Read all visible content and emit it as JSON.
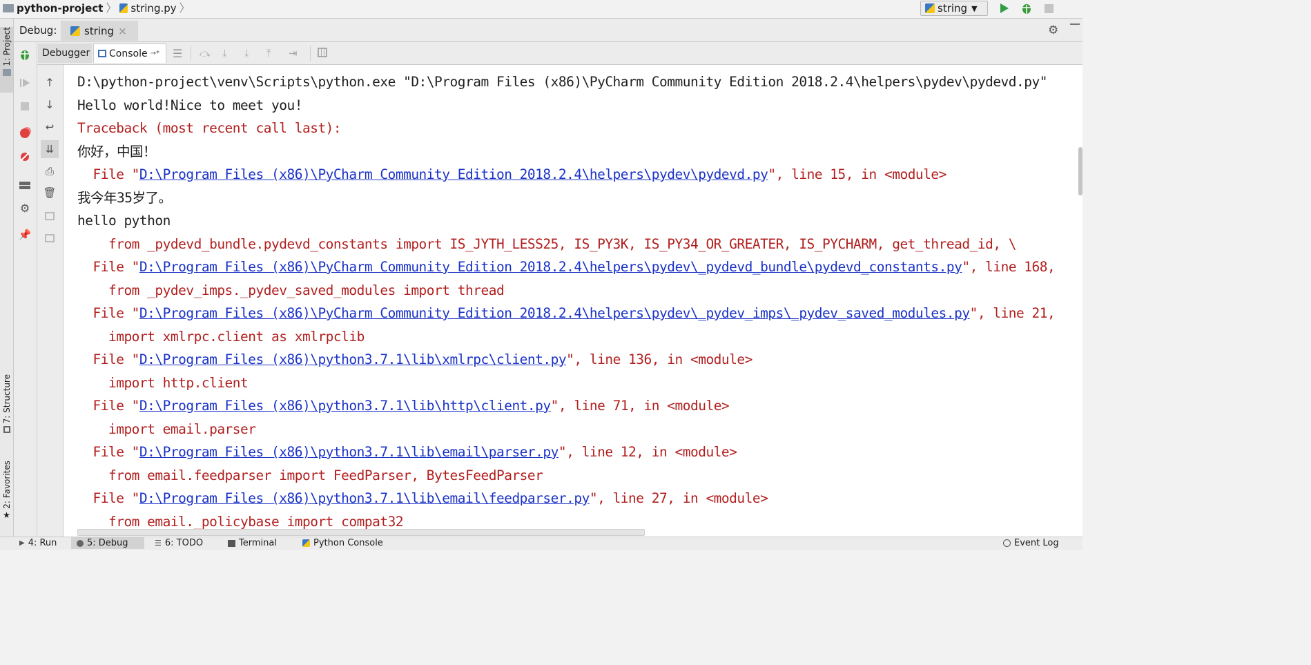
{
  "navbar": {
    "project": "python-project",
    "file": "string.py",
    "run_config": "string"
  },
  "left_stripe": {
    "project_tab": "1: Project",
    "structure_tab": "7: Structure",
    "favorites_tab": "2: Favorites"
  },
  "debug_header": {
    "label": "Debug:",
    "tab_label": "string",
    "tab_close": "×"
  },
  "tabs": {
    "debugger": "Debugger",
    "console": "Console",
    "console_suffix": "→*"
  },
  "console": {
    "lines": [
      {
        "segments": [
          {
            "t": "D:\\python-project\\venv\\Scripts\\python.exe \"D:\\Program Files (x86)\\PyCharm Community Edition 2018.2.4\\helpers\\pydev\\pydevd.py\"",
            "c": "norm"
          }
        ]
      },
      {
        "segments": [
          {
            "t": "Hello world!Nice to meet you!",
            "c": "norm"
          }
        ]
      },
      {
        "segments": [
          {
            "t": "Traceback (most recent call last):",
            "c": "err"
          }
        ]
      },
      {
        "segments": [
          {
            "t": "你好，中国！",
            "c": "norm"
          }
        ]
      },
      {
        "segments": [
          {
            "t": "  File \"",
            "c": "err"
          },
          {
            "t": "D:\\Program Files (x86)\\PyCharm Community Edition 2018.2.4\\helpers\\pydev\\pydevd.py",
            "c": "link"
          },
          {
            "t": "\", line 15, in <module>",
            "c": "err"
          }
        ]
      },
      {
        "segments": [
          {
            "t": "我今年35岁了。",
            "c": "norm"
          }
        ]
      },
      {
        "segments": [
          {
            "t": "hello python",
            "c": "norm"
          }
        ]
      },
      {
        "segments": [
          {
            "t": "    from _pydevd_bundle.pydevd_constants import IS_JYTH_LESS25, IS_PY3K, IS_PY34_OR_GREATER, IS_PYCHARM, get_thread_id, \\",
            "c": "err"
          }
        ]
      },
      {
        "segments": [
          {
            "t": "  File \"",
            "c": "err"
          },
          {
            "t": "D:\\Program Files (x86)\\PyCharm Community Edition 2018.2.4\\helpers\\pydev\\_pydevd_bundle\\pydevd_constants.py",
            "c": "link"
          },
          {
            "t": "\", line 168,",
            "c": "err"
          }
        ]
      },
      {
        "segments": [
          {
            "t": "    from _pydev_imps._pydev_saved_modules import thread",
            "c": "err"
          }
        ]
      },
      {
        "segments": [
          {
            "t": "  File \"",
            "c": "err"
          },
          {
            "t": "D:\\Program Files (x86)\\PyCharm Community Edition 2018.2.4\\helpers\\pydev\\_pydev_imps\\_pydev_saved_modules.py",
            "c": "link"
          },
          {
            "t": "\", line 21,",
            "c": "err"
          }
        ]
      },
      {
        "segments": [
          {
            "t": "    import xmlrpc.client as xmlrpclib",
            "c": "err"
          }
        ]
      },
      {
        "segments": [
          {
            "t": "  File \"",
            "c": "err"
          },
          {
            "t": "D:\\Program Files (x86)\\python3.7.1\\lib\\xmlrpc\\client.py",
            "c": "link"
          },
          {
            "t": "\", line 136, in <module>",
            "c": "err"
          }
        ]
      },
      {
        "segments": [
          {
            "t": "    import http.client",
            "c": "err"
          }
        ]
      },
      {
        "segments": [
          {
            "t": "  File \"",
            "c": "err"
          },
          {
            "t": "D:\\Program Files (x86)\\python3.7.1\\lib\\http\\client.py",
            "c": "link"
          },
          {
            "t": "\", line 71, in <module>",
            "c": "err"
          }
        ]
      },
      {
        "segments": [
          {
            "t": "    import email.parser",
            "c": "err"
          }
        ]
      },
      {
        "segments": [
          {
            "t": "  File \"",
            "c": "err"
          },
          {
            "t": "D:\\Program Files (x86)\\python3.7.1\\lib\\email\\parser.py",
            "c": "link"
          },
          {
            "t": "\", line 12, in <module>",
            "c": "err"
          }
        ]
      },
      {
        "segments": [
          {
            "t": "    from email.feedparser import FeedParser, BytesFeedParser",
            "c": "err"
          }
        ]
      },
      {
        "segments": [
          {
            "t": "  File \"",
            "c": "err"
          },
          {
            "t": "D:\\Program Files (x86)\\python3.7.1\\lib\\email\\feedparser.py",
            "c": "link"
          },
          {
            "t": "\", line 27, in <module>",
            "c": "err"
          }
        ]
      },
      {
        "segments": [
          {
            "t": "    from email._policybase import compat32",
            "c": "err"
          }
        ]
      }
    ]
  },
  "bottom_tabs": {
    "run": "4: Run",
    "debug": "5: Debug",
    "todo": "6: TODO",
    "terminal": "Terminal",
    "python_console": "Python Console",
    "event_log": "Event Log"
  },
  "colors": {
    "error_text": "#b21f1f",
    "link_text": "#1a32c7",
    "run_green": "#2f9e44",
    "debug_green": "#3c9a3c"
  }
}
